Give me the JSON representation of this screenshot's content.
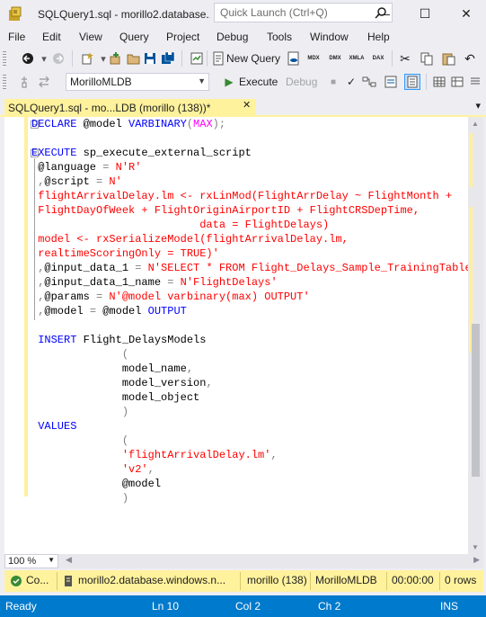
{
  "window": {
    "title": "SQLQuery1.sql - morillo2.database...",
    "quick_launch_placeholder": "Quick Launch (Ctrl+Q)",
    "minimize": "—",
    "maximize": "☐",
    "close": "✕"
  },
  "menu": [
    "File",
    "Edit",
    "View",
    "Query",
    "Project",
    "Debug",
    "Tools",
    "Window",
    "Help"
  ],
  "toolbar1": {
    "new_query": "New Query",
    "icons": [
      "MDX",
      "DMX",
      "XMLA",
      "DAX"
    ]
  },
  "toolbar2": {
    "database": "MorilloMLDB",
    "execute": "Execute",
    "debug": "Debug"
  },
  "tab": {
    "label": "SQLQuery1.sql - mo...LDB (morillo (138))*",
    "close": "✕",
    "pin": "⊞"
  },
  "code": [
    [
      {
        "t": "DECLARE",
        "c": "kw"
      },
      {
        "t": " @model ",
        "c": "black"
      },
      {
        "t": "VARBINARY",
        "c": "kw"
      },
      {
        "t": "(",
        "c": "gray"
      },
      {
        "t": "MAX",
        "c": "fn"
      },
      {
        "t": ");",
        "c": "gray"
      }
    ],
    [],
    [
      {
        "t": "EXECUTE",
        "c": "kw"
      },
      {
        "t": " sp_execute_external_script",
        "c": "black"
      }
    ],
    [
      {
        "t": " @language ",
        "c": "black"
      },
      {
        "t": "=",
        "c": "gray"
      },
      {
        "t": " N'R'",
        "c": "str"
      }
    ],
    [
      {
        "t": " ,",
        "c": "gray"
      },
      {
        "t": "@script ",
        "c": "black"
      },
      {
        "t": "=",
        "c": "gray"
      },
      {
        "t": " N'",
        "c": "str"
      }
    ],
    [
      {
        "t": " flightArrivalDelay.lm <- rxLinMod(FlightArrDelay ~ FlightMonth +",
        "c": "str"
      }
    ],
    [
      {
        "t": " FlightDayOfWeek + FlightOriginAirportID + FlightCRSDepTime,",
        "c": "str"
      }
    ],
    [
      {
        "t": "                          data = FlightDelays)",
        "c": "str"
      }
    ],
    [
      {
        "t": " model <- rxSerializeModel(flightArrivalDelay.lm,",
        "c": "str"
      }
    ],
    [
      {
        "t": " realtimeScoringOnly = TRUE)'",
        "c": "str"
      }
    ],
    [
      {
        "t": " ,",
        "c": "gray"
      },
      {
        "t": "@input_data_1 ",
        "c": "black"
      },
      {
        "t": "=",
        "c": "gray"
      },
      {
        "t": " N'SELECT * FROM Flight_Delays_Sample_TrainingTable'",
        "c": "str"
      }
    ],
    [
      {
        "t": " ,",
        "c": "gray"
      },
      {
        "t": "@input_data_1_name ",
        "c": "black"
      },
      {
        "t": "=",
        "c": "gray"
      },
      {
        "t": " N'FlightDelays'",
        "c": "str"
      }
    ],
    [
      {
        "t": " ,",
        "c": "gray"
      },
      {
        "t": "@params ",
        "c": "black"
      },
      {
        "t": "=",
        "c": "gray"
      },
      {
        "t": " N'@model varbinary(max) OUTPUT'",
        "c": "str"
      }
    ],
    [
      {
        "t": " ,",
        "c": "gray"
      },
      {
        "t": "@model ",
        "c": "black"
      },
      {
        "t": "=",
        "c": "gray"
      },
      {
        "t": " @model ",
        "c": "black"
      },
      {
        "t": "OUTPUT",
        "c": "kw"
      }
    ],
    [],
    [
      {
        "t": " INSERT",
        "c": "kw"
      },
      {
        "t": " Flight_DelaysModels",
        "c": "black"
      }
    ],
    [
      {
        "t": "              (",
        "c": "gray"
      }
    ],
    [
      {
        "t": "              model_name",
        "c": "black"
      },
      {
        "t": ",",
        "c": "gray"
      }
    ],
    [
      {
        "t": "              model_version",
        "c": "black"
      },
      {
        "t": ",",
        "c": "gray"
      }
    ],
    [
      {
        "t": "              model_object",
        "c": "black"
      }
    ],
    [
      {
        "t": "              )",
        "c": "gray"
      }
    ],
    [
      {
        "t": " VALUES",
        "c": "kw"
      }
    ],
    [
      {
        "t": "              (",
        "c": "gray"
      }
    ],
    [
      {
        "t": "              'flightArrivalDelay.lm'",
        "c": "str"
      },
      {
        "t": ",",
        "c": "gray"
      }
    ],
    [
      {
        "t": "              'v2'",
        "c": "str"
      },
      {
        "t": ",",
        "c": "gray"
      }
    ],
    [
      {
        "t": "              @model",
        "c": "black"
      }
    ],
    [
      {
        "t": "              )",
        "c": "gray"
      }
    ]
  ],
  "zoom": "100 %",
  "query_status": {
    "state": "Co...",
    "server": "morillo2.database.windows.n...",
    "user": "morillo (138)",
    "database": "MorilloMLDB",
    "elapsed": "00:00:00",
    "rows": "0 rows"
  },
  "statusbar": {
    "ready": "Ready",
    "line": "Ln 10",
    "col": "Col 2",
    "ch": "Ch 2",
    "mode": "INS"
  },
  "colors": {
    "accent": "#007ACC",
    "tab_yellow": "#FFF29D",
    "keyword": "#0000FF",
    "string": "#FF0000"
  }
}
